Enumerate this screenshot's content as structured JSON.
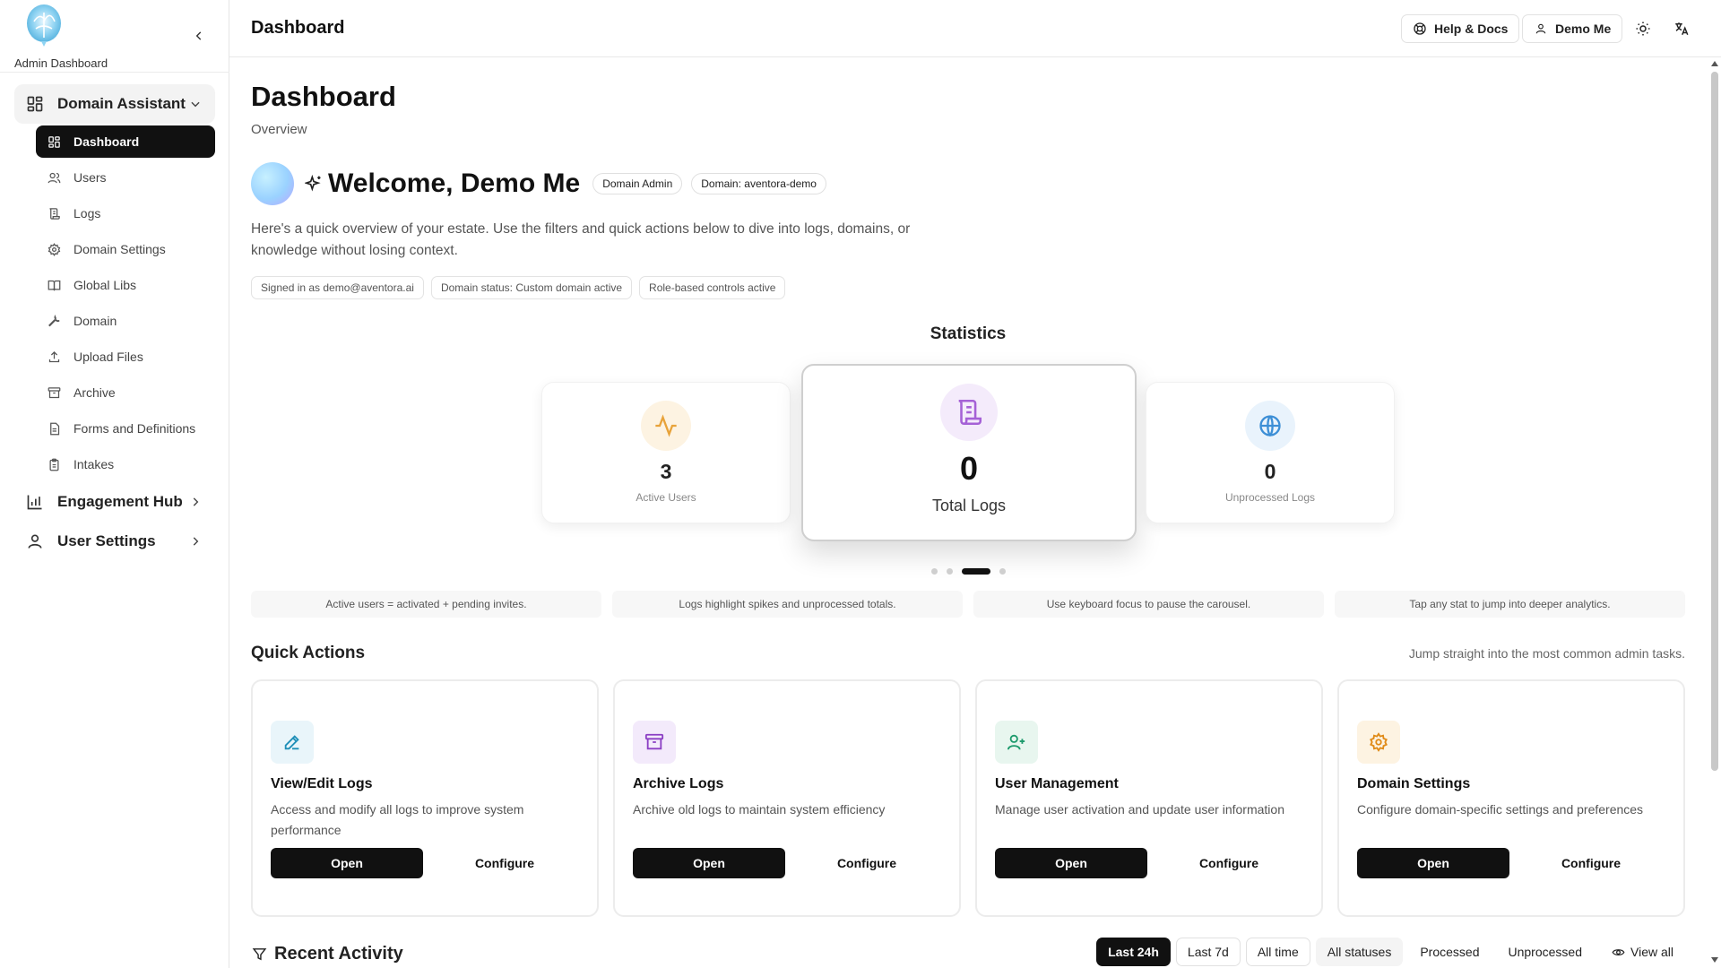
{
  "sidebar": {
    "brand_label": "Admin Dashboard",
    "groups": [
      {
        "label": "Domain Assistant",
        "icon": "grid-icon",
        "expanded": true
      },
      {
        "label": "Engagement Hub",
        "icon": "bar-chart-icon",
        "expanded": false
      },
      {
        "label": "User Settings",
        "icon": "user-icon",
        "expanded": false
      }
    ],
    "items": [
      {
        "label": "Dashboard",
        "icon": "grid-icon",
        "active": true
      },
      {
        "label": "Users",
        "icon": "users-icon"
      },
      {
        "label": "Logs",
        "icon": "scroll-icon"
      },
      {
        "label": "Domain Settings",
        "icon": "gear-icon"
      },
      {
        "label": "Global Libs",
        "icon": "book-icon"
      },
      {
        "label": "Domain",
        "icon": "wrench-icon"
      },
      {
        "label": "Upload Files",
        "icon": "upload-icon"
      },
      {
        "label": "Archive",
        "icon": "archive-icon"
      },
      {
        "label": "Forms and Definitions",
        "icon": "file-icon"
      },
      {
        "label": "Intakes",
        "icon": "clipboard-icon"
      }
    ]
  },
  "header": {
    "title": "Dashboard",
    "help_label": "Help & Docs",
    "user_label": "Demo Me"
  },
  "page": {
    "title": "Dashboard",
    "subtitle": "Overview",
    "welcome": "Welcome, Demo Me",
    "chips": [
      "Domain Admin",
      "Domain: aventora-demo"
    ],
    "intro": "Here's a quick overview of your estate. Use the filters and quick actions below to dive into logs, domains, or knowledge without losing context.",
    "info_chips": [
      "Signed in as demo@aventora.ai",
      "Domain status: Custom domain active",
      "Role-based controls active"
    ]
  },
  "statistics": {
    "title": "Statistics",
    "cards": [
      {
        "value": "3",
        "label": "Active Users",
        "icon": "activity-icon",
        "color": "#e8a33a",
        "bg": "#fdf3e2"
      },
      {
        "value": "0",
        "label": "Total Logs",
        "icon": "scroll-icon",
        "color": "#a561d6",
        "bg": "#f4ebfb"
      },
      {
        "value": "0",
        "label": "Unprocessed Logs",
        "icon": "globe-icon",
        "color": "#3d8fd6",
        "bg": "#e9f3fc"
      }
    ],
    "carousel_active_index": 2,
    "carousel_count": 4,
    "tips": [
      "Active users = activated + pending invites.",
      "Logs highlight spikes and unprocessed totals.",
      "Use keyboard focus to pause the carousel.",
      "Tap any stat to jump into deeper analytics."
    ]
  },
  "quick_actions": {
    "title": "Quick Actions",
    "subtitle": "Jump straight into the most common admin tasks.",
    "open_label": "Open",
    "configure_label": "Configure",
    "cards": [
      {
        "name": "View/Edit Logs",
        "desc": "Access and modify all logs to improve system performance",
        "icon": "pencil-icon",
        "color": "#1f8fb8",
        "bg": "#e9f5fa"
      },
      {
        "name": "Archive Logs",
        "desc": "Archive old logs to maintain system efficiency",
        "icon": "archive-icon",
        "color": "#8b3fc4",
        "bg": "#f3eafb"
      },
      {
        "name": "User Management",
        "desc": "Manage user activation and update user information",
        "icon": "user-plus-icon",
        "color": "#1d9a6c",
        "bg": "#e8f6ef"
      },
      {
        "name": "Domain Settings",
        "desc": "Configure domain-specific settings and preferences",
        "icon": "gear-icon",
        "color": "#e08a16",
        "bg": "#fdf3e2"
      }
    ]
  },
  "recent_activity": {
    "title": "Recent Activity",
    "filters": [
      "Last 24h",
      "Last 7d",
      "All time",
      "All statuses",
      "Processed",
      "Unprocessed"
    ],
    "view_all": "View all"
  }
}
